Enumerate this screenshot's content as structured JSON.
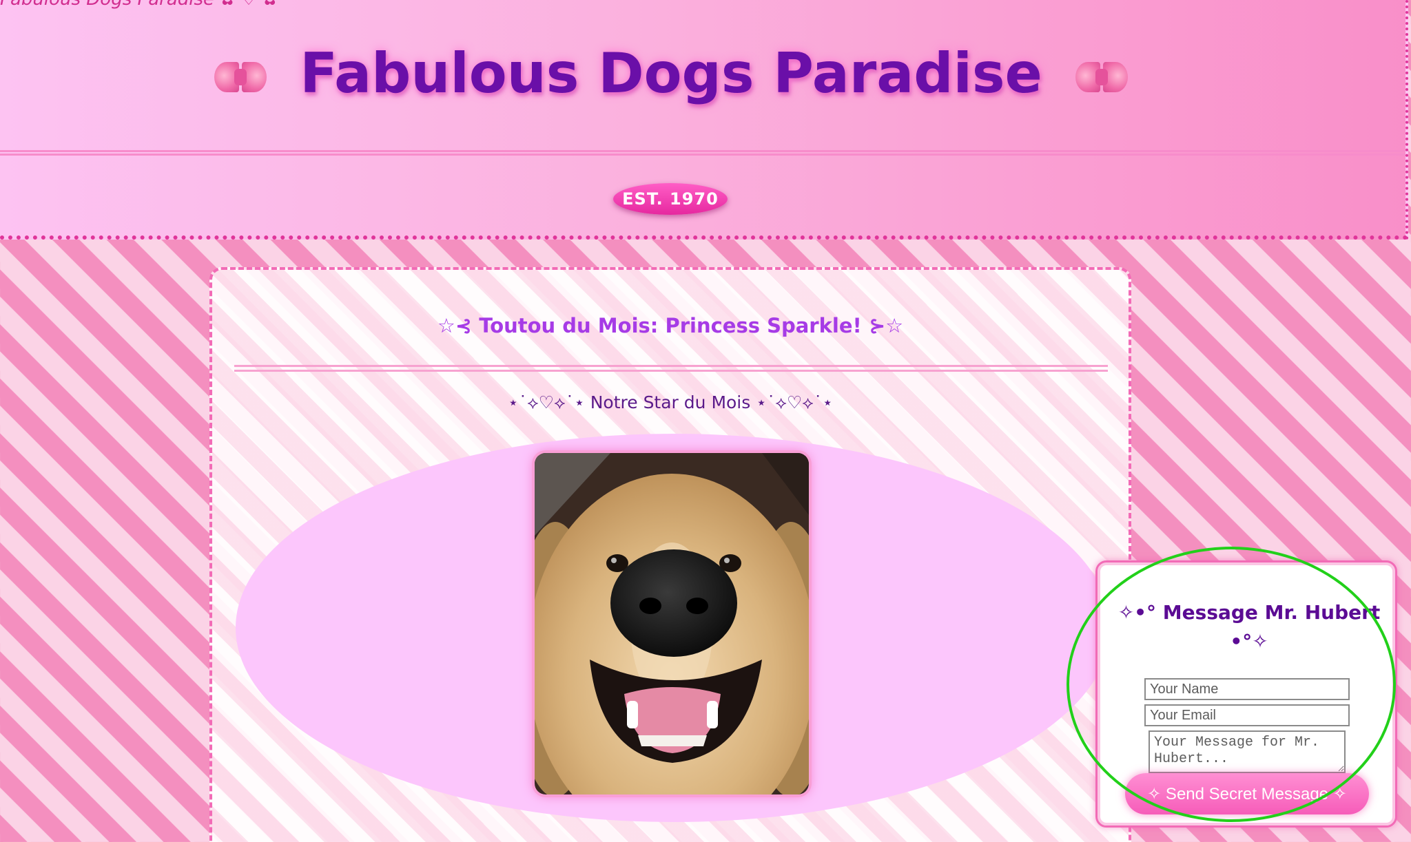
{
  "header": {
    "marquee_text": "Fabulous Dogs Paradise ✿ ♡ ✿",
    "title": "Fabulous Dogs Paradise",
    "established_badge": "EST. 1970"
  },
  "main": {
    "dog_of_month_title": "☆⊰ Toutou du Mois: Princess Sparkle! ⊱☆",
    "star_subtitle": "⋆˙⟡♡⟡˙⋆ Notre Star du Mois ⋆˙⟡♡⟡˙⋆",
    "photo_icon": "golden-retriever-photo"
  },
  "contact": {
    "title": "✧•° Message Mr. Hubert •°✧",
    "name_placeholder": "Your Name",
    "email_placeholder": "Your Email",
    "message_placeholder": "Your Message for Mr. Hubert...",
    "send_label": "✧ Send Secret Message ✧"
  },
  "colors": {
    "title_purple": "#6a0fa8",
    "accent_pink": "#f26bb6",
    "badge_magenta": "#e6289f",
    "highlight_green": "#22d01a"
  }
}
